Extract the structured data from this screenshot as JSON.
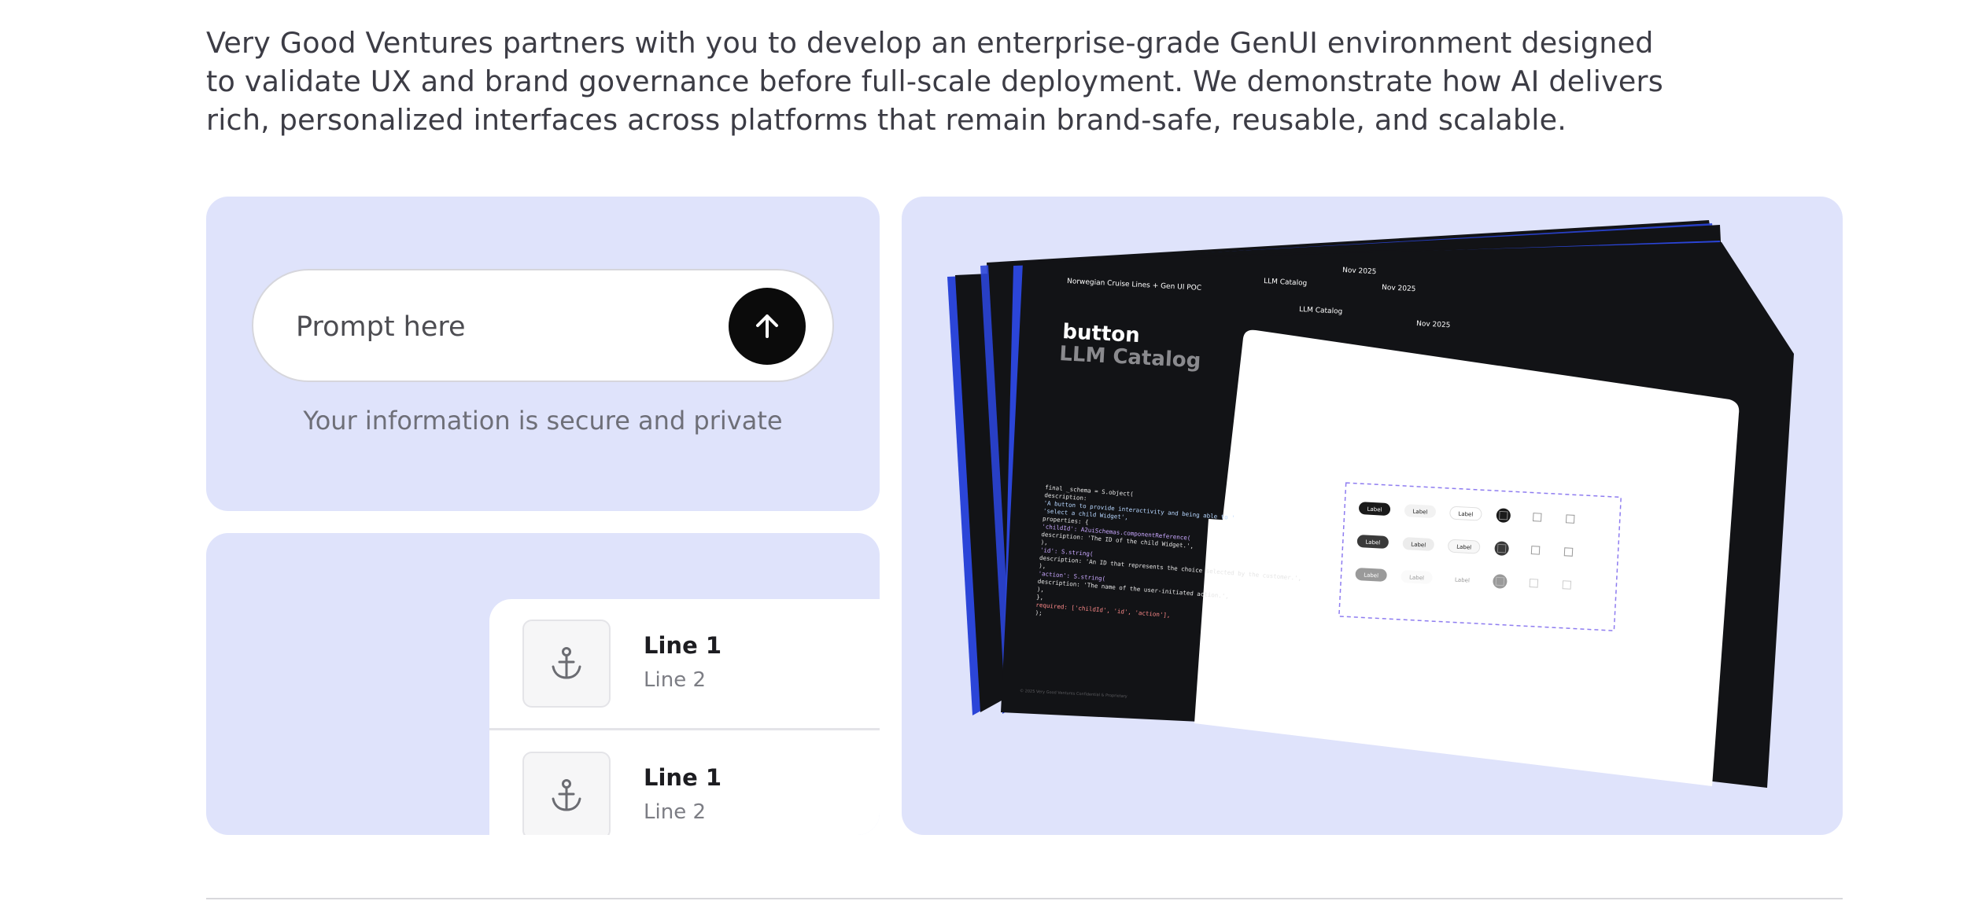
{
  "intro": {
    "text": "Very Good Ventures partners with you to develop an enterprise-grade GenUI environment designed to validate UX and brand governance before full-scale deployment. We demonstrate how AI delivers rich, personalized interfaces across platforms that remain brand-safe, reusable, and scalable."
  },
  "prompt": {
    "placeholder": "Prompt here",
    "send_icon": "arrow-up-icon",
    "note": "Your information is secure and private"
  },
  "list": {
    "items": [
      {
        "icon": "anchor-icon",
        "line1": "Line 1",
        "line2": "Line 2"
      },
      {
        "icon": "anchor-icon",
        "line1": "Line 1",
        "line2": "Line 2"
      }
    ]
  },
  "preview": {
    "header_left": "Norwegian Cruise Lines + Gen UI POC",
    "header_mid": "LLM Catalog",
    "header_date_top": "Nov 2025",
    "header_date_mid": "Nov 2025",
    "header_llm_back": "LLM Catalog",
    "header_date_back": "Nov 2025",
    "title_main": "button",
    "title_sub": "LLM Catalog",
    "widget_label": "Label",
    "code_lines": [
      "final _schema = S.object(",
      "  description:",
      "      'A button to provide interactivity and being able to '",
      "      'select a child Widget',",
      "  properties: {",
      "    'childId': A2uiSchemas.componentReference(",
      "      description: 'The ID of the child Widget.',",
      "    ),",
      "    'id': S.string(",
      "      description: 'An ID that represents the choice selected by the customer.',",
      "    ),",
      "    'action': S.string(",
      "      description: 'The name of the user-initiated action.',",
      "    ),",
      "  },",
      "  required: ['childId', 'id', 'action'],",
      ");"
    ],
    "footer": "© 2025 Very Good Ventures   Confidential & Proprietary"
  },
  "colors": {
    "card_bg": "#dfe3fb",
    "slide_dark": "#121316",
    "accent_blue": "#2b45d8",
    "dashed_purple": "#8e7cf0"
  }
}
